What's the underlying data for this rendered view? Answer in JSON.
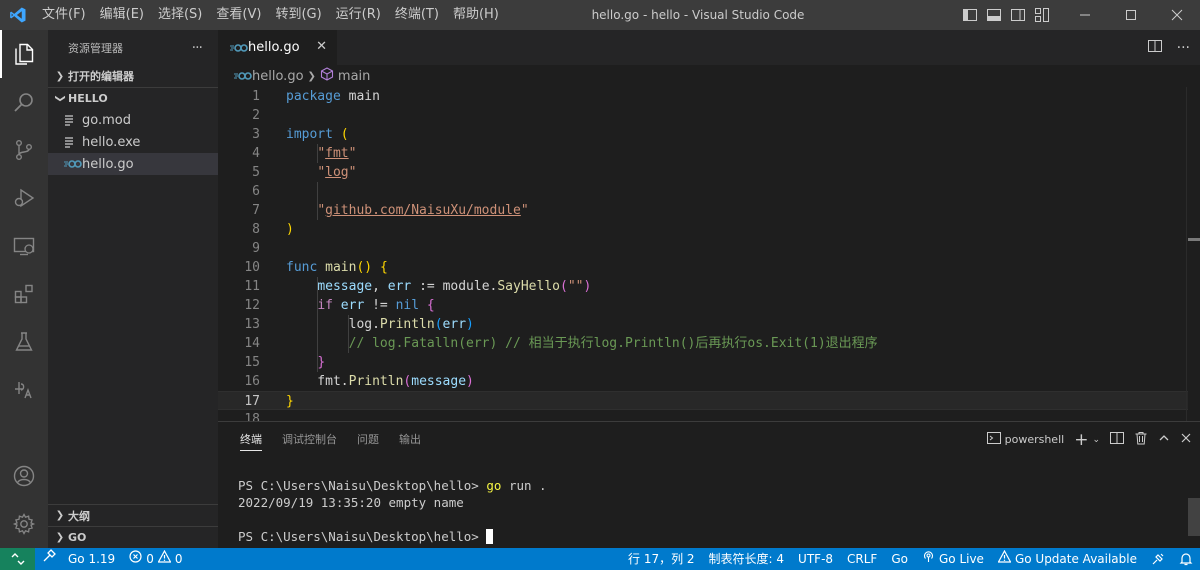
{
  "window": {
    "title": "hello.go - hello - Visual Studio Code",
    "menu": [
      "文件(F)",
      "编辑(E)",
      "选择(S)",
      "查看(V)",
      "转到(G)",
      "运行(R)",
      "终端(T)",
      "帮助(H)"
    ]
  },
  "activity_bar": {
    "items": [
      "explorer-icon",
      "search-icon",
      "source-control-icon",
      "run-debug-icon",
      "remote-explorer-icon",
      "extensions-icon",
      "testing-icon",
      "docker-icon"
    ],
    "bottom": [
      "account-icon",
      "settings-gear-icon"
    ]
  },
  "sidebar": {
    "title": "资源管理器",
    "more": "···",
    "open_editors": "打开的编辑器",
    "folder": "HELLO",
    "files": [
      {
        "name": "go.mod",
        "icon": "lines-icon"
      },
      {
        "name": "hello.exe",
        "icon": "lines-icon"
      },
      {
        "name": "hello.go",
        "icon": "go-file-icon",
        "selected": true
      }
    ],
    "outline": "大纲",
    "go_section": "GO"
  },
  "editor": {
    "tab_label": "hello.go",
    "close_glyph": "✕",
    "breadcrumb": {
      "file": "hello.go",
      "symbol": "main"
    },
    "current_line": 17
  },
  "panel": {
    "tabs": [
      "终端",
      "调试控制台",
      "问题",
      "输出"
    ],
    "active_tab": "终端",
    "shell": "powershell",
    "terminal_lines": [
      {
        "prompt": "PS C:\\Users\\Naisu\\Desktop\\hello> ",
        "cmd": "go",
        "rest": " run ."
      },
      {
        "prompt": "2022/09/19 13:35:20 empty name",
        "cmd": "",
        "rest": ""
      },
      {
        "prompt": "",
        "cmd": "",
        "rest": ""
      },
      {
        "prompt": "PS C:\\Users\\Naisu\\Desktop\\hello> ",
        "cmd": "",
        "rest": ""
      }
    ]
  },
  "status_bar": {
    "go_version": "Go 1.19",
    "errors": "0",
    "warnings": "0",
    "position": "行 17，列 2",
    "indent": "制表符长度: 4",
    "encoding": "UTF-8",
    "eol": "CRLF",
    "language": "Go",
    "live": "Go Live",
    "update": "Go Update Available"
  },
  "colors": {
    "statusbar": "#007acc",
    "remote": "#16825d",
    "keyword": "#569cd6",
    "string": "#ce9178",
    "comment": "#6a9955"
  }
}
